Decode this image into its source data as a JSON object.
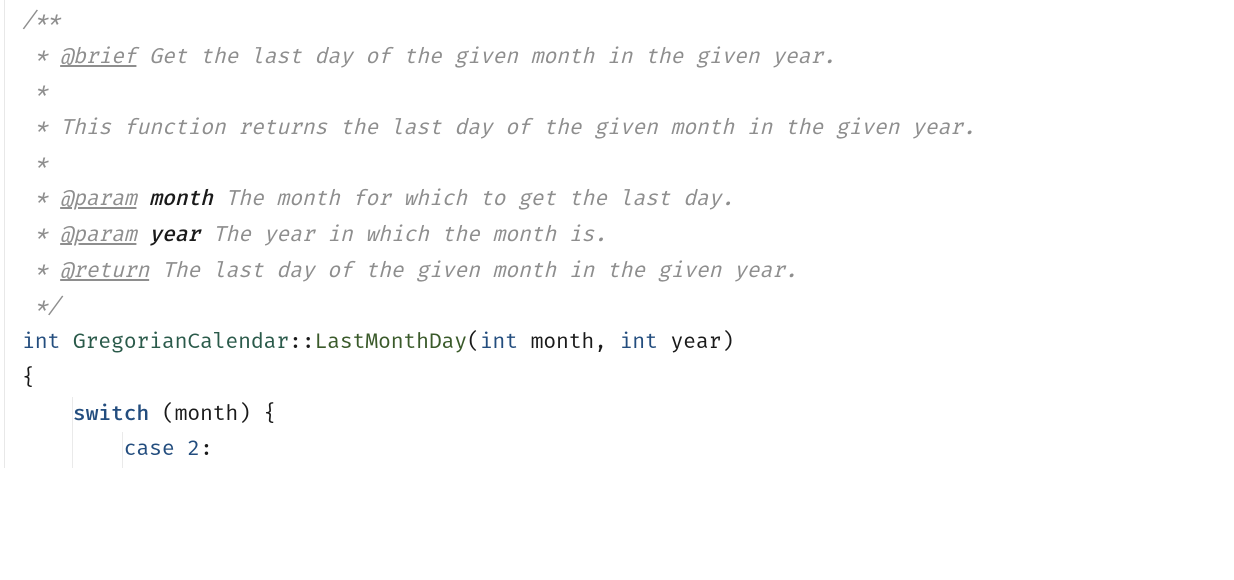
{
  "code": {
    "l1": "/**",
    "l2_star": " * ",
    "l2_tag": "@brief",
    "l2_rest": " Get the last day of the given month in the given year.",
    "l3": " *",
    "l4": " * This function returns the last day of the given month in the given year.",
    "l5": " *",
    "l6_star": " * ",
    "l6_tag": "@param",
    "l6_sp": " ",
    "l6_name": "month",
    "l6_rest": " The month for which to get the last day.",
    "l7_star": " * ",
    "l7_tag": "@param",
    "l7_sp": " ",
    "l7_name": "year",
    "l7_rest": " The year in which the month is.",
    "l8_star": " * ",
    "l8_tag": "@return",
    "l8_rest": " The last day of the given month in the given year.",
    "l9": " */",
    "l10_int": "int",
    "l10_sp1": " ",
    "l10_class": "GregorianCalendar",
    "l10_sep": "::",
    "l10_func": "LastMonthDay",
    "l10_open": "(",
    "l10_t1": "int",
    "l10_sp2": " ",
    "l10_p1": "month",
    "l10_comma": ", ",
    "l10_t2": "int",
    "l10_sp3": " ",
    "l10_p2": "year",
    "l10_close": ")",
    "l11": "{",
    "l12_indent": "    ",
    "l12_kw": "switch",
    "l12_rest": " (month) {",
    "l13_indent": "        ",
    "l13_kw": "case",
    "l13_sp": " ",
    "l13_num": "2",
    "l13_colon": ":"
  }
}
